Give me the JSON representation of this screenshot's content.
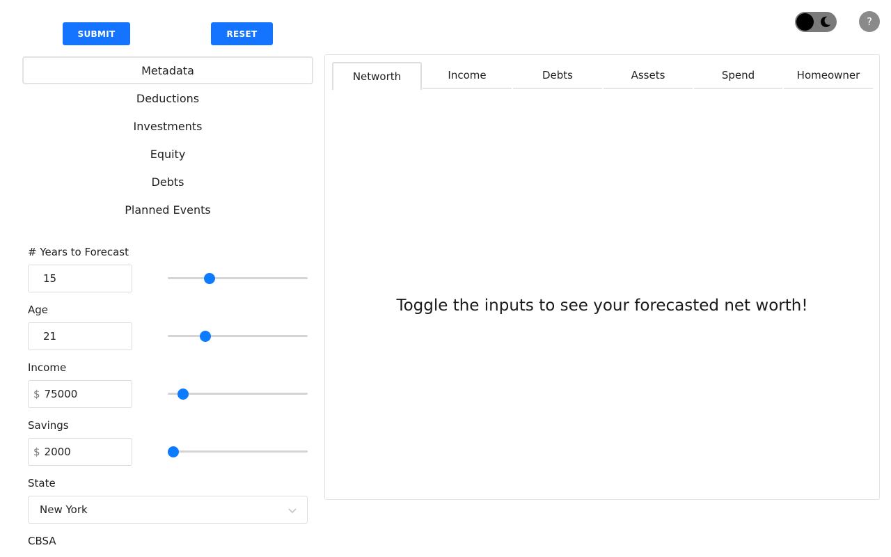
{
  "toolbar": {
    "submit_label": "SUBMIT",
    "reset_label": "RESET",
    "help_label": "?"
  },
  "colors": {
    "accent": "#1473ff",
    "slider_thumb": "#0d7bff",
    "toggle_bg": "#7a7a7a"
  },
  "menu": {
    "items": [
      {
        "label": "Metadata",
        "active": true
      },
      {
        "label": "Deductions"
      },
      {
        "label": "Investments"
      },
      {
        "label": "Equity"
      },
      {
        "label": "Debts"
      },
      {
        "label": "Planned Events"
      }
    ]
  },
  "form": {
    "years": {
      "label": "# Years to Forecast",
      "value": "15",
      "slider_fraction": 0.3
    },
    "age": {
      "label": "Age",
      "value": "21",
      "slider_fraction": 0.27
    },
    "income": {
      "label": "Income",
      "prefix": "$",
      "value": "75000",
      "slider_fraction": 0.11
    },
    "savings": {
      "label": "Savings",
      "prefix": "$",
      "value": "2000",
      "slider_fraction": 0.04
    },
    "state": {
      "label": "State",
      "value": "New York"
    },
    "cbsa": {
      "label": "CBSA"
    }
  },
  "tabs": [
    {
      "label": "Networth",
      "active": true
    },
    {
      "label": "Income"
    },
    {
      "label": "Debts"
    },
    {
      "label": "Assets"
    },
    {
      "label": "Spend"
    },
    {
      "label": "Homeowner"
    }
  ],
  "main": {
    "message": "Toggle the inputs to see your forecasted net worth!"
  }
}
